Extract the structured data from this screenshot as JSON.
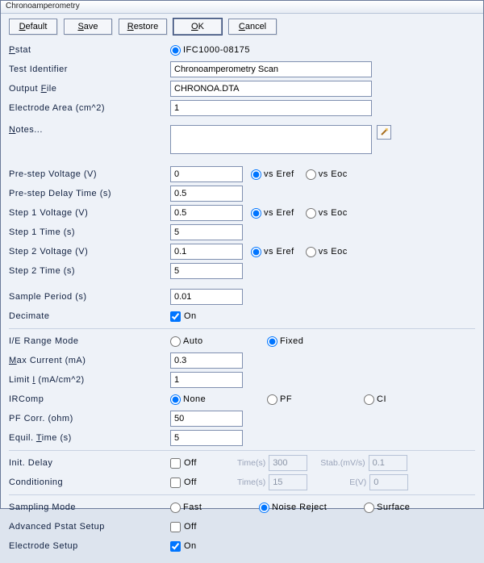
{
  "window": {
    "title": "Chronoamperometry"
  },
  "toolbar": {
    "default": "Default",
    "save": "Save",
    "restore": "Restore",
    "ok": "OK",
    "cancel": "Cancel"
  },
  "labels": {
    "pstat": "Pstat",
    "test_identifier": "Test Identifier",
    "output_file": "Output File",
    "electrode_area": "Electrode Area (cm^2)",
    "notes": "Notes...",
    "prestep_v": "Pre-step Voltage (V)",
    "prestep_delay": "Pre-step Delay Time (s)",
    "step1_v": "Step 1 Voltage (V)",
    "step1_t": "Step 1 Time (s)",
    "step2_v": "Step 2 Voltage (V)",
    "step2_t": "Step 2 Time (s)",
    "sample_period": "Sample Period (s)",
    "decimate": "Decimate",
    "ie_range": "I/E Range Mode",
    "max_current": "Max Current (mA)",
    "limit_i": "Limit I (mA/cm^2)",
    "ircomp": "IRComp",
    "pf_corr": "PF Corr. (ohm)",
    "equil_time": "Equil. Time (s)",
    "init_delay": "Init. Delay",
    "conditioning": "Conditioning",
    "sampling_mode": "Sampling Mode",
    "adv_pstat": "Advanced Pstat Setup",
    "elec_setup": "Electrode Setup"
  },
  "opts": {
    "pstat_device": "IFC1000-08175",
    "vs_eref": "vs Eref",
    "vs_eoc": "vs Eoc",
    "on": "On",
    "off": "Off",
    "auto": "Auto",
    "fixed": "Fixed",
    "none": "None",
    "pf": "PF",
    "ci": "CI",
    "fast": "Fast",
    "noise_reject": "Noise Reject",
    "surface": "Surface",
    "time_s": "Time(s)",
    "stab": "Stab.(mV/s)",
    "ev": "E(V)"
  },
  "values": {
    "test_identifier": "Chronoamperometry Scan",
    "output_file": "CHRONOA.DTA",
    "electrode_area": "1",
    "notes": "",
    "prestep_v": "0",
    "prestep_delay": "0.5",
    "step1_v": "0.5",
    "step1_t": "5",
    "step2_v": "0.1",
    "step2_t": "5",
    "sample_period": "0.01",
    "max_current": "0.3",
    "limit_i": "1",
    "pf_corr": "50",
    "equil_time": "5",
    "init_delay_time": "300",
    "init_delay_stab": "0.1",
    "cond_time": "15",
    "cond_ev": "0"
  },
  "state": {
    "pstat_selected": true,
    "prestep_ref": "eref",
    "step1_ref": "eref",
    "step2_ref": "eref",
    "decimate_on": true,
    "ie_range": "fixed",
    "ircomp": "none",
    "init_delay_off": false,
    "conditioning_off": false,
    "sampling_mode": "noise_reject",
    "adv_pstat_off": false,
    "elec_setup_on": true
  }
}
